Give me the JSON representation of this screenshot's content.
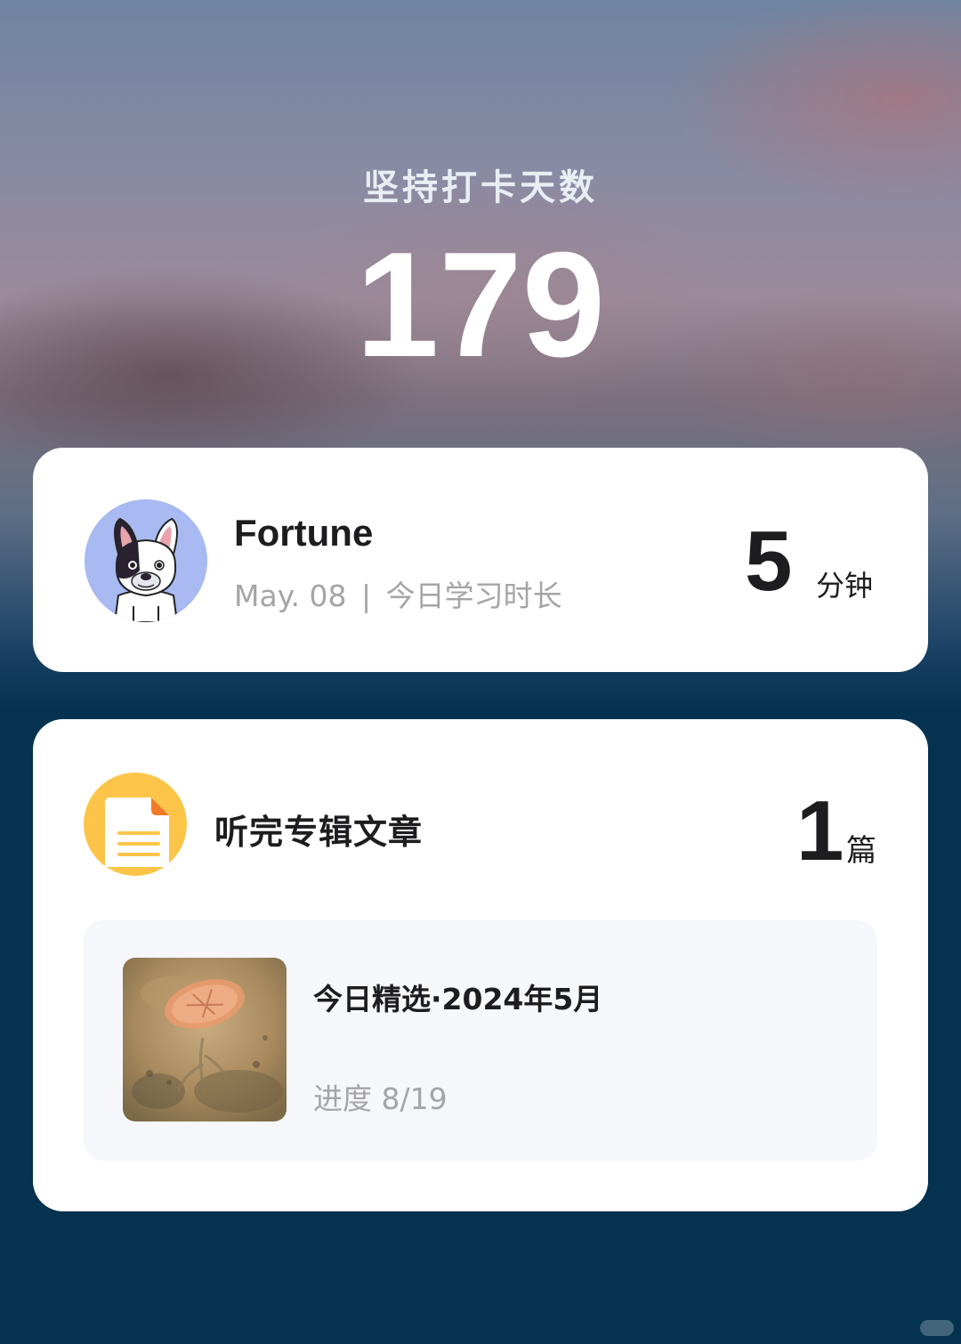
{
  "streak": {
    "title": "坚持打卡天数",
    "days": "179"
  },
  "user_card": {
    "name": "Fortune",
    "date": "May. 08",
    "separator": "|",
    "study_label": "今日学习时长",
    "minutes_value": "5",
    "minutes_unit": "分钟",
    "avatar_icon": "french-bulldog-avatar"
  },
  "listen_card": {
    "icon": "document-icon",
    "title": "听完专辑文章",
    "count_value": "1",
    "count_unit": "篇",
    "album": {
      "title": "今日精选·2024年5月",
      "progress_label": "进度 8/19"
    }
  },
  "colors": {
    "card_bg": "#ffffff",
    "page_bottom_bg": "#04324f",
    "doc_icon_bg": "#fcc54a",
    "doc_icon_accent": "#f47a2a",
    "avatar_bg": "#a9b9f2"
  }
}
